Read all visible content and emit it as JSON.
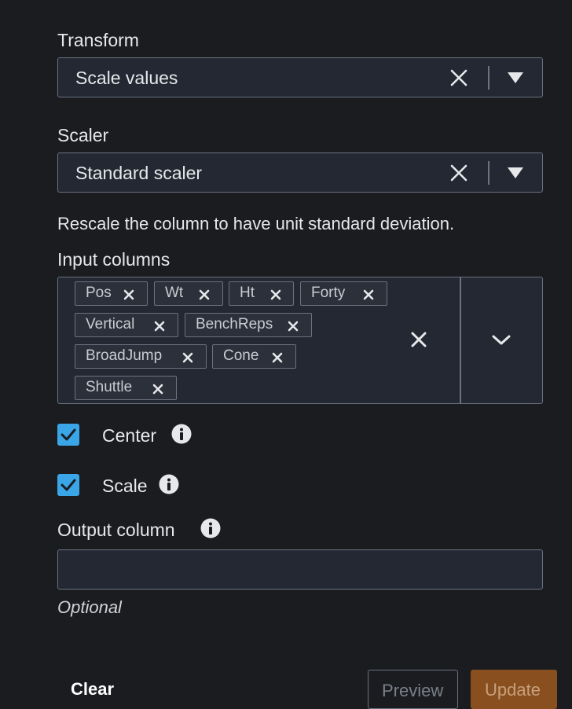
{
  "transform": {
    "label": "Transform",
    "value": "Scale values"
  },
  "scaler": {
    "label": "Scaler",
    "value": "Standard scaler",
    "description": "Rescale the column to have unit standard deviation."
  },
  "input_columns": {
    "label": "Input columns",
    "tokens": [
      "Pos",
      "Wt",
      "Ht",
      "Forty",
      "Vertical",
      "BenchReps",
      "BroadJump",
      "Cone",
      "Shuttle"
    ]
  },
  "options": {
    "center": {
      "label": "Center",
      "checked": true
    },
    "scale": {
      "label": "Scale",
      "checked": true
    }
  },
  "output_column": {
    "label": "Output column",
    "value": "",
    "hint": "Optional"
  },
  "footer": {
    "clear_label": "Clear",
    "preview_label": "Preview",
    "update_label": "Update"
  },
  "colors": {
    "checkbox": "#3aa6e8",
    "update_button": "#8a4f1f",
    "background": "#1a1c20",
    "field": "#232833"
  },
  "icons": {
    "clear": "close-icon",
    "dropdown": "caret-down-icon",
    "expand": "chevron-down-icon",
    "info": "info-icon",
    "check": "check-icon"
  }
}
